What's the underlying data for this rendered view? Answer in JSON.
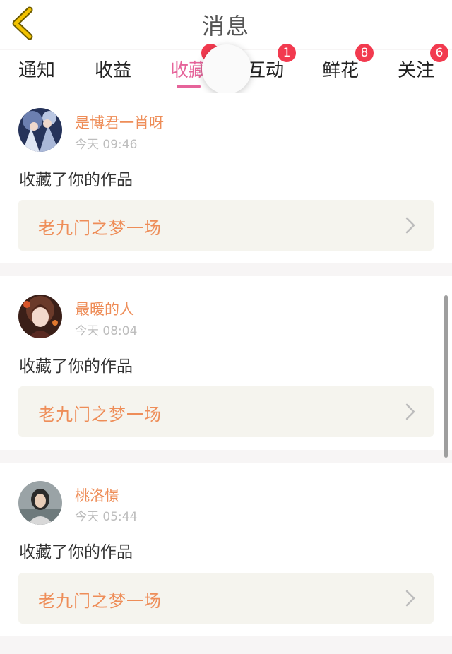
{
  "header": {
    "title": "消息",
    "back_icon": "chevron-left-icon",
    "back_color": "#f2c200"
  },
  "tabs": [
    {
      "label": "通知",
      "badge": null
    },
    {
      "label": "收益",
      "badge": null
    },
    {
      "label": "收藏",
      "badge": "",
      "active": true
    },
    {
      "label": "互动",
      "badge": "1"
    },
    {
      "label": "鲜花",
      "badge": "8"
    },
    {
      "label": "关注",
      "badge": "6"
    }
  ],
  "colors": {
    "accent": "#e6639a",
    "badge": "#f23a4f",
    "name": "#ee8d58"
  },
  "notifications": [
    {
      "user": "是博君一肖呀",
      "time": "今天 09:46",
      "action": "收藏了你的作品",
      "work": "老九门之梦一场"
    },
    {
      "user": "最暖的人",
      "time": "今天 08:04",
      "action": "收藏了你的作品",
      "work": "老九门之梦一场"
    },
    {
      "user": "桃洛憬",
      "time": "今天 05:44",
      "action": "收藏了你的作品",
      "work": "老九门之梦一场"
    }
  ]
}
